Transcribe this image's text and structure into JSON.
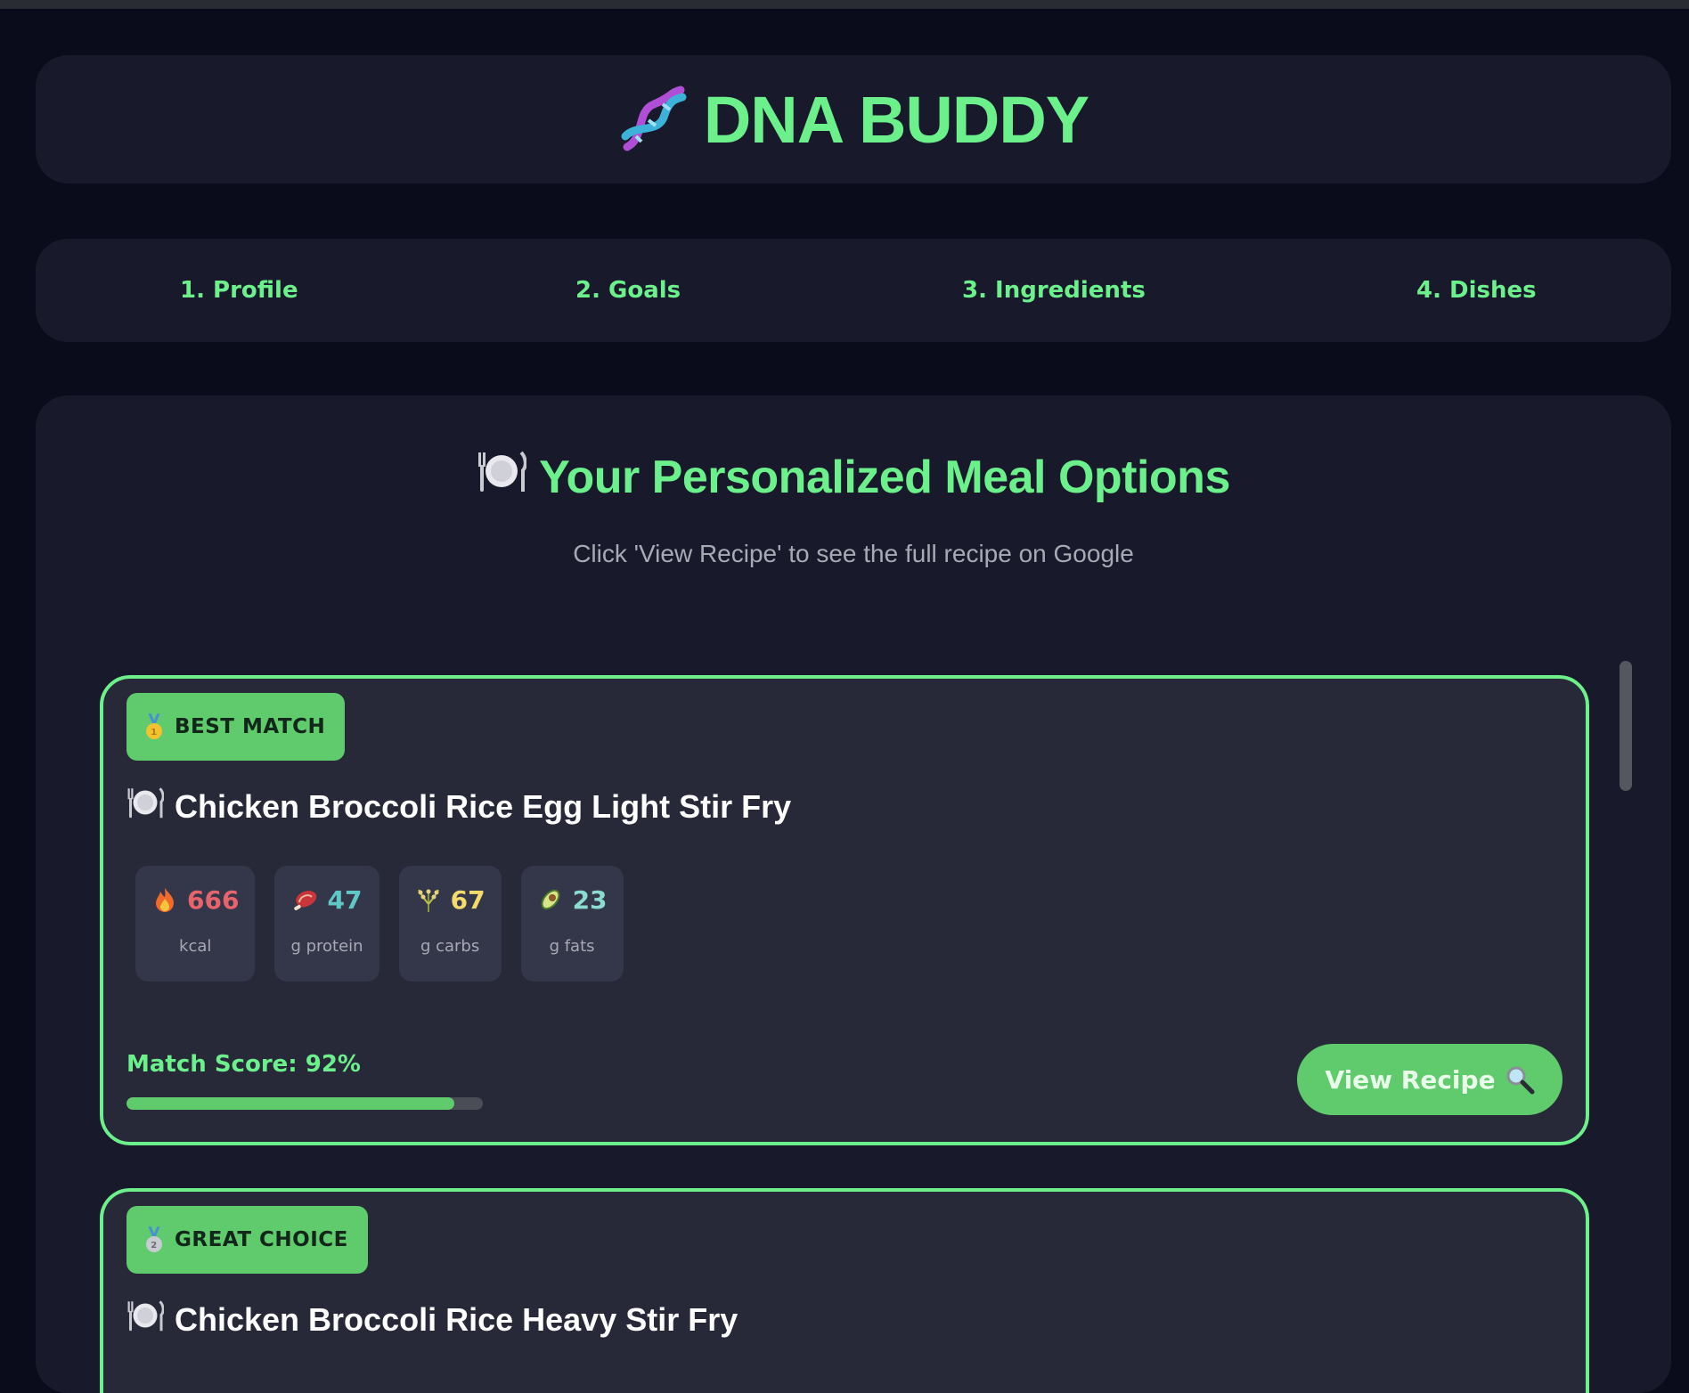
{
  "header": {
    "title": "DNA BUDDY",
    "icon": "dna-icon"
  },
  "steps": [
    {
      "label": "1. Profile"
    },
    {
      "label": "2. Goals"
    },
    {
      "label": "3. Ingredients"
    },
    {
      "label": "4. Dishes"
    }
  ],
  "main": {
    "title": "Your Personalized Meal Options",
    "title_icon": "plate-icon",
    "subtitle": "Click 'View Recipe' to see the full recipe on Google"
  },
  "cards": [
    {
      "badge": "BEST MATCH",
      "badge_icon": "gold-medal-icon",
      "name": "Chicken Broccoli Rice Egg Light Stir Fry",
      "nutrients": [
        {
          "icon": "fire-icon",
          "value": "666",
          "unit": "kcal",
          "color": "#e8646c"
        },
        {
          "icon": "meat-icon",
          "value": "47",
          "unit": "g protein",
          "color": "#5fc8c6"
        },
        {
          "icon": "rice-icon",
          "value": "67",
          "unit": "g carbs",
          "color": "#f4da6a"
        },
        {
          "icon": "avocado-icon",
          "value": "23",
          "unit": "g fats",
          "color": "#8adbd0"
        }
      ],
      "match_label": "Match Score: 92%",
      "match_score": 0.92,
      "button": "View Recipe",
      "button_icon": "search-icon"
    },
    {
      "badge": "GREAT CHOICE",
      "badge_icon": "silver-medal-icon",
      "name": "Chicken Broccoli Rice Heavy Stir Fry"
    }
  ],
  "colors": {
    "accent": "#6cf08c",
    "button": "#5fcb6c",
    "background": "#0a0c1b",
    "panel": "#181a2b",
    "card": "#272939"
  }
}
